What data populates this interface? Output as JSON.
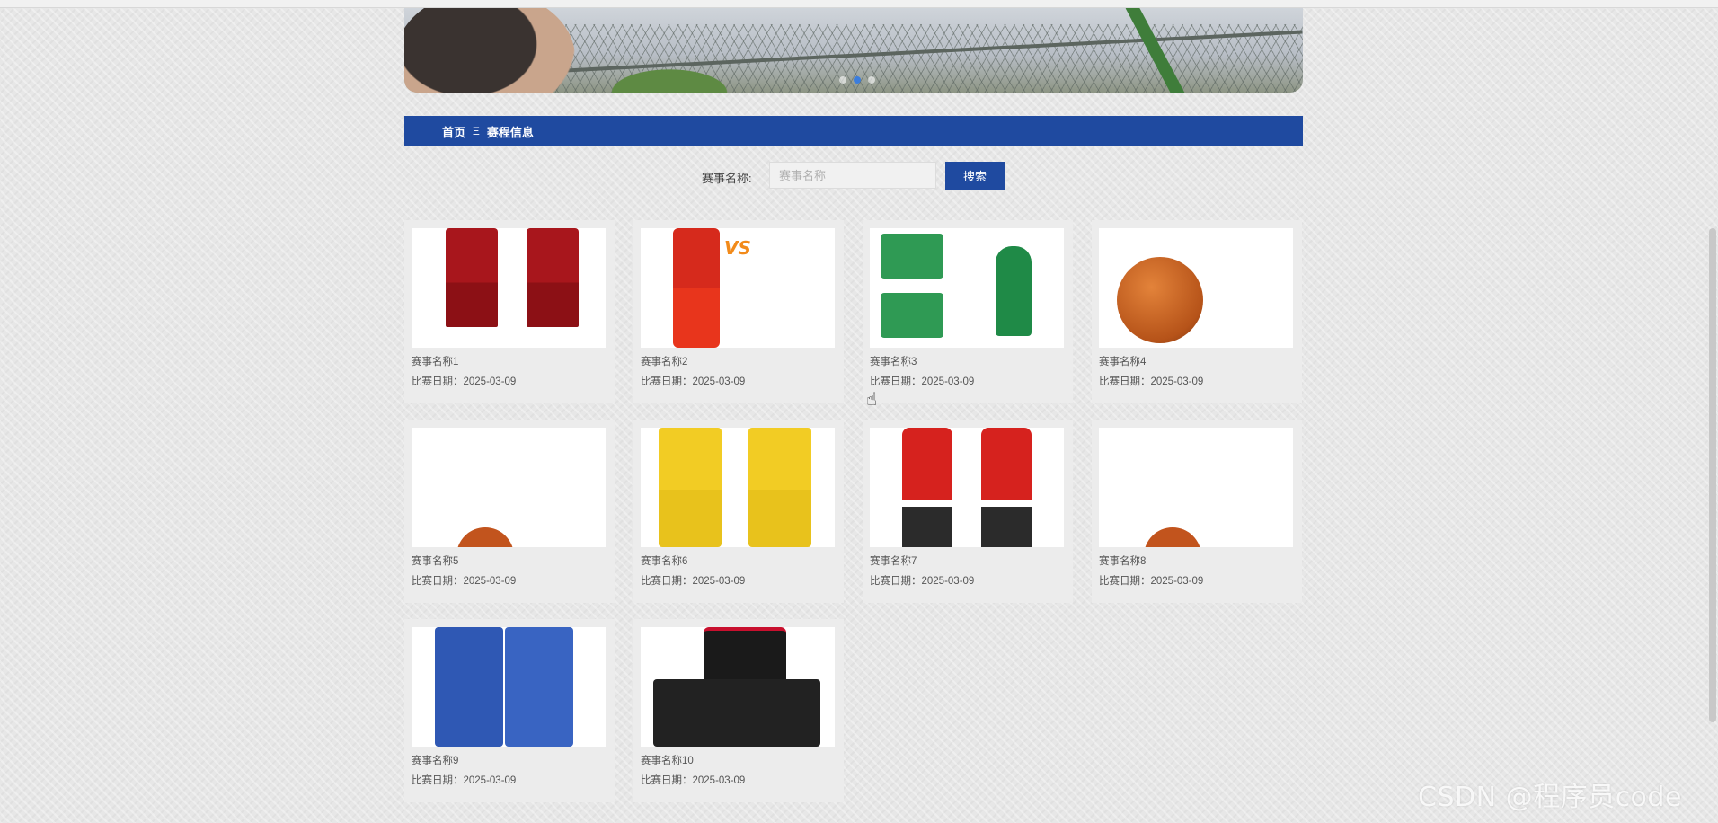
{
  "breadcrumb": {
    "home": "首页",
    "separator": "Ξ",
    "current": "赛程信息"
  },
  "search": {
    "label": "赛事名称:",
    "placeholder": "赛事名称",
    "value": "",
    "button": "搜索"
  },
  "matches": [
    {
      "name": "赛事名称1",
      "date_label": "比赛日期：2025-03-09",
      "image": "red-basketball-kit"
    },
    {
      "name": "赛事名称2",
      "date_label": "比赛日期：2025-03-09",
      "image": "china-vs-kids"
    },
    {
      "name": "赛事名称3",
      "date_label": "比赛日期：2025-03-09",
      "image": "green-celtics-jerseys"
    },
    {
      "name": "赛事名称4",
      "date_label": "比赛日期：2025-03-09",
      "image": "basketball-on-court"
    },
    {
      "name": "赛事名称5",
      "date_label": "比赛日期：2025-03-09",
      "image": "basketball-net"
    },
    {
      "name": "赛事名称6",
      "date_label": "比赛日期：2025-03-09",
      "image": "yellow-basketball-kit"
    },
    {
      "name": "赛事名称7",
      "date_label": "比赛日期：2025-03-09",
      "image": "china-red-kit"
    },
    {
      "name": "赛事名称8",
      "date_label": "比赛日期：2025-03-09",
      "image": "basketball-net"
    },
    {
      "name": "赛事名称9",
      "date_label": "比赛日期：2025-03-09",
      "image": "clippers-blue-jersey"
    },
    {
      "name": "赛事名称10",
      "date_label": "比赛日期：2025-03-09",
      "image": "sixers-black-kit"
    }
  ],
  "watermark": "CSDN @程序员code",
  "colors": {
    "primary": "#1f4aa0",
    "card_bg": "#ececec",
    "text": "#555555"
  }
}
